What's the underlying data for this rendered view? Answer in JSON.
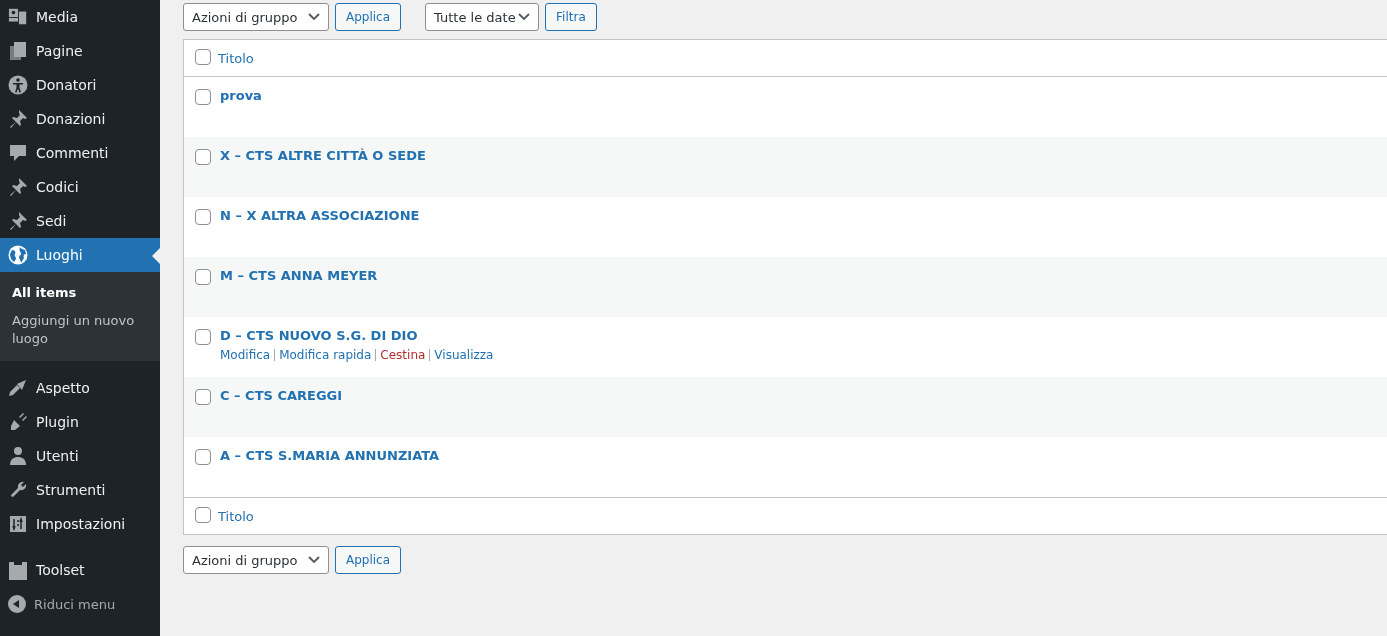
{
  "sidebar": {
    "items": [
      {
        "label": "Media",
        "selected": false
      },
      {
        "label": "Pagine",
        "selected": false
      },
      {
        "label": "Donatori",
        "selected": false
      },
      {
        "label": "Donazioni",
        "selected": false
      },
      {
        "label": "Commenti",
        "selected": false
      },
      {
        "label": "Codici",
        "selected": false
      },
      {
        "label": "Sedi",
        "selected": false
      },
      {
        "label": "Luoghi",
        "selected": true,
        "children": [
          {
            "label": "All items",
            "selected": true
          },
          {
            "label": "Aggiungi un nuovo luogo",
            "selected": false
          }
        ]
      },
      {
        "label": "Aspetto",
        "selected": false
      },
      {
        "label": "Plugin",
        "selected": false
      },
      {
        "label": "Utenti",
        "selected": false
      },
      {
        "label": "Strumenti",
        "selected": false
      },
      {
        "label": "Impostazioni",
        "selected": false
      },
      {
        "label": "Toolset",
        "selected": false,
        "separated": true
      }
    ],
    "collapse": "Riduci menu"
  },
  "top_actions": {
    "bulk": "Azioni di gruppo",
    "apply": "Applica",
    "dates": "Tutte le date",
    "filter": "Filtra"
  },
  "table": {
    "header": {
      "label": "Titolo",
      "checked": false
    },
    "rows": [
      {
        "title": "prova",
        "checked": false
      },
      {
        "title": "X – CTS ALTRE CITTÀ O SEDE",
        "checked": false
      },
      {
        "title": "N – X ALTRA ASSOCIAZIONE",
        "checked": false
      },
      {
        "title": "M – CTS ANNA MEYER",
        "checked": false
      },
      {
        "title": "D – CTS NUOVO S.G. DI DIO",
        "checked": false,
        "actions": [
          {
            "label": "Modifica",
            "kind": "normal"
          },
          {
            "label": "Modifica rapida",
            "kind": "normal"
          },
          {
            "label": "Cestina",
            "kind": "delete"
          },
          {
            "label": "Visualizza",
            "kind": "normal"
          }
        ]
      },
      {
        "title": "C – CTS CAREGGI",
        "checked": false
      },
      {
        "title": "A – CTS S.MARIA ANNUNZIATA",
        "checked": false
      }
    ],
    "footer": {
      "label": "Titolo",
      "checked": false
    }
  },
  "bottom_actions": {
    "bulk": "Azioni di gruppo",
    "apply": "Applica"
  }
}
